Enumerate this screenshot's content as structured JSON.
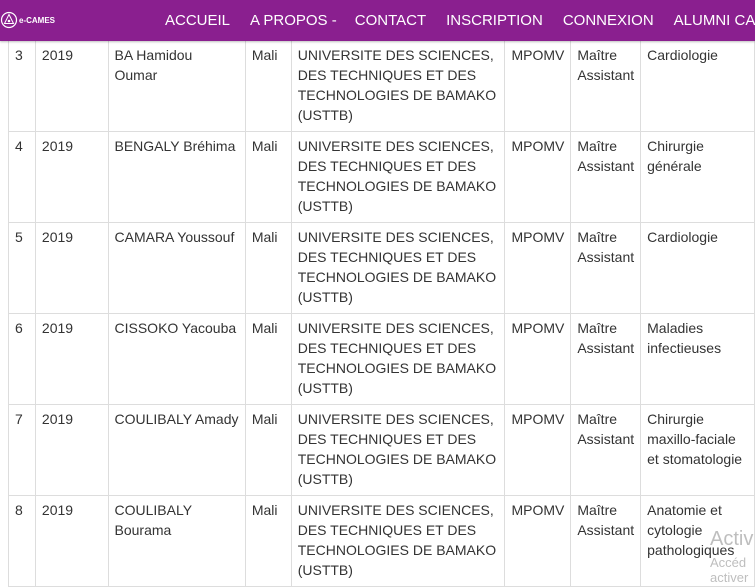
{
  "navbar": {
    "logo_text": "e-CAMES",
    "items": [
      {
        "label": "ACCUEIL"
      },
      {
        "label": "A PROPOS -"
      },
      {
        "label": "CONTACT"
      },
      {
        "label": "INSCRIPTION"
      },
      {
        "label": "CONNEXION"
      },
      {
        "label": "ALUMNI CAMES"
      }
    ],
    "background_color": "#8a1f8f"
  },
  "table": {
    "rows": [
      {
        "num": "3",
        "year": "2019",
        "name": "BA Hamidou Oumar",
        "country": "Mali",
        "university": "UNIVERSITE DES SCIENCES, DES TECHNIQUES ET DES TECHNOLOGIES DE BAMAKO (USTTB)",
        "ctp": "MPOMV",
        "grade": "Maître Assistant",
        "specialty": "Cardiologie"
      },
      {
        "num": "4",
        "year": "2019",
        "name": "BENGALY Bréhima",
        "country": "Mali",
        "university": "UNIVERSITE DES SCIENCES, DES TECHNIQUES ET DES TECHNOLOGIES DE BAMAKO (USTTB)",
        "ctp": "MPOMV",
        "grade": "Maître Assistant",
        "specialty": "Chirurgie générale"
      },
      {
        "num": "5",
        "year": "2019",
        "name": "CAMARA Youssouf",
        "country": "Mali",
        "university": "UNIVERSITE DES SCIENCES, DES TECHNIQUES ET DES TECHNOLOGIES DE BAMAKO (USTTB)",
        "ctp": "MPOMV",
        "grade": "Maître Assistant",
        "specialty": "Cardiologie"
      },
      {
        "num": "6",
        "year": "2019",
        "name": "CISSOKO Yacouba",
        "country": "Mali",
        "university": "UNIVERSITE DES SCIENCES, DES TECHNIQUES ET DES TECHNOLOGIES DE BAMAKO (USTTB)",
        "ctp": "MPOMV",
        "grade": "Maître Assistant",
        "specialty": "Maladies infectieuses"
      },
      {
        "num": "7",
        "year": "2019",
        "name": "COULIBALY Amady",
        "country": "Mali",
        "university": "UNIVERSITE DES SCIENCES, DES TECHNIQUES ET DES TECHNOLOGIES DE BAMAKO (USTTB)",
        "ctp": "MPOMV",
        "grade": "Maître Assistant",
        "specialty": "Chirurgie maxillo-faciale et stomatologie"
      },
      {
        "num": "8",
        "year": "2019",
        "name": "COULIBALY Bourama",
        "country": "Mali",
        "university": "UNIVERSITE DES SCIENCES, DES TECHNIQUES ET DES TECHNOLOGIES DE BAMAKO (USTTB)",
        "ctp": "MPOMV",
        "grade": "Maître Assistant",
        "specialty": "Anatomie et cytologie pathologiques"
      }
    ]
  },
  "watermark": {
    "title": "Activ",
    "line1": "Accéd",
    "line2": "activer"
  }
}
